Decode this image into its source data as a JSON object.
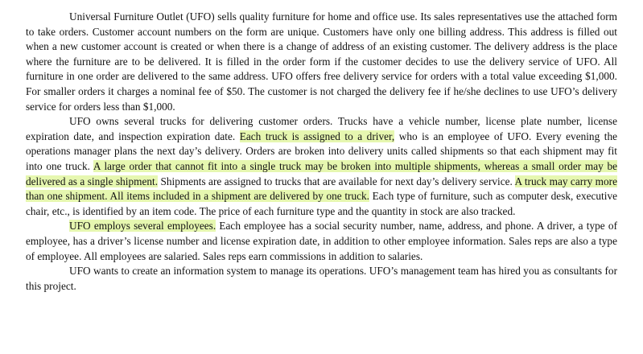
{
  "document": {
    "highlight_color": "#e6f7b0",
    "paragraphs": [
      {
        "segments": [
          {
            "text": "Universal Furniture Outlet (UFO) sells quality furniture for home and office use.  Its sales representatives use the attached form to take orders.  Customer account numbers on the form are unique.  Customers have only one billing address.  This address is filled out when a new customer account is created or when there is a change of address of an existing customer.  The delivery address is the place where the furniture are to be delivered.  It is filled in the order form if the customer decides to use the delivery service of UFO.  All furniture in one order are delivered to the same address.  UFO offers free delivery service for orders with a total value exceeding $1,000.  For smaller orders it charges a nominal fee of $50.  The customer is not charged the delivery fee if he/she declines to use UFO’s delivery service for orders less than $1,000.",
            "highlighted": false
          }
        ]
      },
      {
        "segments": [
          {
            "text": "UFO owns several trucks for delivering customer orders.  Trucks have a vehicle number, license plate number, license expiration date, and inspection expiration date.  ",
            "highlighted": false
          },
          {
            "text": "Each truck is assigned to a driver,",
            "highlighted": true
          },
          {
            "text": " who is an employee of UFO.  Every evening the operations manager plans the next day’s delivery.  Orders are broken into delivery units called shipments so that each shipment may fit into one truck.  ",
            "highlighted": false
          },
          {
            "text": "A large order that cannot fit into a single truck may be broken into multiple shipments, whereas a small order may be delivered as a single shipment.",
            "highlighted": true
          },
          {
            "text": "  Shipments are assigned to trucks that are available for next day’s delivery service.  ",
            "highlighted": false
          },
          {
            "text": "A truck may carry more than one shipment.  All items included in a shipment are delivered by one truck.",
            "highlighted": true
          },
          {
            "text": "  Each type of furniture, such as computer desk, executive chair, etc., is identified by an item code.  The price of each furniture type and the quantity in stock are also tracked.",
            "highlighted": false
          }
        ]
      },
      {
        "segments": [
          {
            "text": "UFO employs several employees.",
            "highlighted": true
          },
          {
            "text": "  Each employee has a social security number, name, address, and phone.  A driver, a type of employee, has a driver’s license number and license expiration date, in addition to other employee information.  Sales reps are also a type of employee.  All employees are salaried.  Sales reps earn commissions in addition to salaries.",
            "highlighted": false
          }
        ]
      },
      {
        "segments": [
          {
            "text": "UFO wants to create an information system to manage its operations.  UFO’s management team has hired you as consultants for this project.",
            "highlighted": false
          }
        ]
      }
    ]
  }
}
